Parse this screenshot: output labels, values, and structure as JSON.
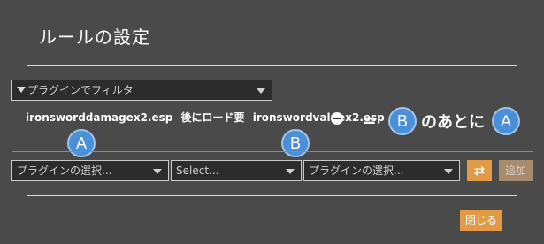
{
  "title": "ルールの設定",
  "filter": {
    "placeholder": "プラグインでフィルタ"
  },
  "rule": {
    "plugin_a": "ironsworddamagex2.esp",
    "relation": "後にロード要",
    "plugin_b": "ironswordvaluex2.esp"
  },
  "annotation": {
    "a_label": "A",
    "b_label": "B",
    "equals": "=",
    "after_text": "のあとに"
  },
  "add_rule": {
    "first_select": "プラグインの選択...",
    "relation_select": "Select...",
    "second_select": "プラグインの選択...",
    "swap_icon": "⇄",
    "add_label": "追加"
  },
  "close_label": "閉じる",
  "colors": {
    "background": "#4a4a4a",
    "accent": "#e39a45",
    "bubble": "#4b8fd6"
  }
}
